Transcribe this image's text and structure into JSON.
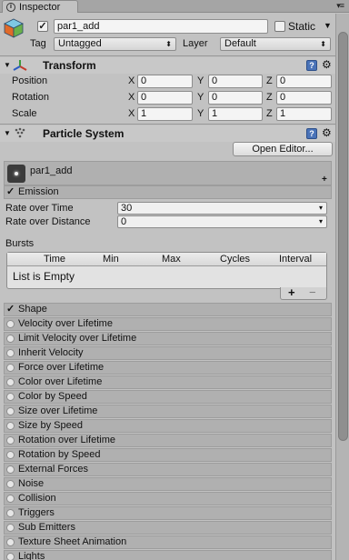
{
  "tab": {
    "label": "Inspector"
  },
  "gameobject": {
    "name": "par1_add",
    "static_label": "Static",
    "tag_label": "Tag",
    "tag_value": "Untagged",
    "layer_label": "Layer",
    "layer_value": "Default"
  },
  "transform": {
    "title": "Transform",
    "position_label": "Position",
    "rotation_label": "Rotation",
    "scale_label": "Scale",
    "axis_x": "X",
    "axis_y": "Y",
    "axis_z": "Z",
    "position": {
      "x": "0",
      "y": "0",
      "z": "0"
    },
    "rotation": {
      "x": "0",
      "y": "0",
      "z": "0"
    },
    "scale": {
      "x": "1",
      "y": "1",
      "z": "1"
    }
  },
  "particle_system": {
    "title": "Particle System",
    "open_editor_label": "Open Editor...",
    "system_name": "par1_add",
    "emission_label": "Emission",
    "rate_over_time_label": "Rate over Time",
    "rate_over_time_value": "30",
    "rate_over_distance_label": "Rate over Distance",
    "rate_over_distance_value": "0",
    "bursts_label": "Bursts",
    "bursts_columns": [
      "Time",
      "Min",
      "Max",
      "Cycles",
      "Interval"
    ],
    "bursts_empty": "List is Empty",
    "add_label": "+",
    "remove_label": "−",
    "shape_label": "Shape",
    "modules": [
      "Velocity over Lifetime",
      "Limit Velocity over Lifetime",
      "Inherit Velocity",
      "Force over Lifetime",
      "Color over Lifetime",
      "Color by Speed",
      "Size over Lifetime",
      "Size by Speed",
      "Rotation over Lifetime",
      "Rotation by Speed",
      "External Forces",
      "Noise",
      "Collision",
      "Triggers",
      "Sub Emitters",
      "Texture Sheet Animation",
      "Lights"
    ]
  }
}
